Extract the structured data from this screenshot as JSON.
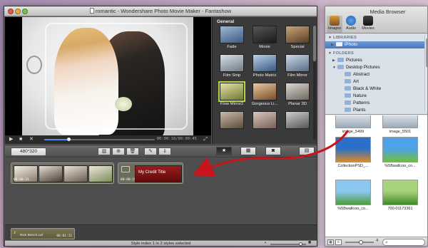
{
  "window": {
    "title": "romantic - Wondershare Photo Movie Maker - Fantashow"
  },
  "preview": {
    "timecode": "00:00:10/00:00:45",
    "progress_fraction": 0.22
  },
  "styles_panel": {
    "header": "General",
    "items": [
      {
        "label": "Fade",
        "colors": [
          "#9eb7d6",
          "#3d5a80"
        ]
      },
      {
        "label": "Movie",
        "colors": [
          "#555555",
          "#1a1a1a"
        ]
      },
      {
        "label": "Special",
        "colors": [
          "#c7a57a",
          "#5b3d22"
        ]
      },
      {
        "label": "Film Strip",
        "colors": [
          "#d9e0e8",
          "#6f7b88"
        ]
      },
      {
        "label": "Photo Matrix",
        "colors": [
          "#bcd0e8",
          "#36577f"
        ]
      },
      {
        "label": "Film Mirror",
        "colors": [
          "#cfd9e6",
          "#566b85"
        ]
      },
      {
        "label": "Flow Mirror2",
        "colors": [
          "#e6e0a8",
          "#6d7a33"
        ]
      },
      {
        "label": "Gorgeous Li...",
        "colors": [
          "#e8c9a2",
          "#7a4b2a"
        ]
      },
      {
        "label": "Planar 3D",
        "colors": [
          "#dad6d0",
          "#6e6a62"
        ]
      },
      {
        "label": "",
        "colors": [
          "#c7b9a8",
          "#5d4c3c"
        ]
      },
      {
        "label": "",
        "colors": [
          "#d6c8c0",
          "#7b5f52"
        ]
      },
      {
        "label": "",
        "colors": [
          "#cfcfcf",
          "#555555"
        ]
      }
    ]
  },
  "toolbar": {
    "resolution": "480*320",
    "tools": [
      "▥",
      "⊕",
      "🗑",
      "✎",
      "⇓"
    ],
    "view_segments": [
      "★",
      "▦",
      "◙"
    ],
    "export_icon": "▤"
  },
  "storyboard": {
    "photo_group_time": "00:00:31",
    "photo_colors": [
      [
        "#f1efe9",
        "#8c7a66"
      ],
      [
        "#e6ddd2",
        "#4a3e35"
      ],
      [
        "#e9e3dc",
        "#6a5a4c"
      ],
      [
        "#eee7d8",
        "#7c8c5d"
      ]
    ],
    "title_clip_label": "My Credit Title",
    "title_clip_time": "00:00:15"
  },
  "music": {
    "name": "Rick Bench.caf",
    "duration": "00:01:11"
  },
  "status": {
    "text": "Style index 1 in 2 styles selected"
  },
  "media_browser": {
    "title": "Media Browser",
    "tabs": [
      "Images",
      "Audio",
      "Movies"
    ],
    "libraries_header": "LIBRARIES",
    "iphoto": "iPhoto",
    "folders_header": "FOLDERS",
    "folders": [
      {
        "label": "Pictures",
        "level": 1,
        "expanded": false
      },
      {
        "label": "Desktop Pictures",
        "level": 1,
        "expanded": true
      },
      {
        "label": "Abstract",
        "level": 2
      },
      {
        "label": "Art",
        "level": 2
      },
      {
        "label": "Black & White",
        "level": 2
      },
      {
        "label": "Nature",
        "level": 2
      },
      {
        "label": "Patterns",
        "level": 2
      },
      {
        "label": "Plants",
        "level": 2
      }
    ],
    "photos": [
      {
        "caption": "image_5499",
        "colors": [
          "#dfe6ee",
          "#9aa9b7"
        ]
      },
      {
        "caption": "image_5501",
        "colors": [
          "#dfe6ee",
          "#9aa9b7"
        ]
      },
      {
        "caption": "CollectionPSD_...",
        "colors": [
          "#2a6fc9",
          "#d98a2b"
        ]
      },
      {
        "caption": "%5Bwallcoo_co...",
        "colors": [
          "#4ea3e8",
          "#6fbe3c"
        ]
      },
      {
        "caption": "%5Bwallcoo_co...",
        "colors": [
          "#8cc7f0",
          "#4d9d3a"
        ]
      },
      {
        "caption": "700-01173361",
        "colors": [
          "#a8d27c",
          "#3f8a2a"
        ]
      }
    ],
    "count": "4",
    "search_placeholder": "",
    "zoom_fraction": 0.55
  },
  "annotation": {
    "color": "#c8141a"
  }
}
